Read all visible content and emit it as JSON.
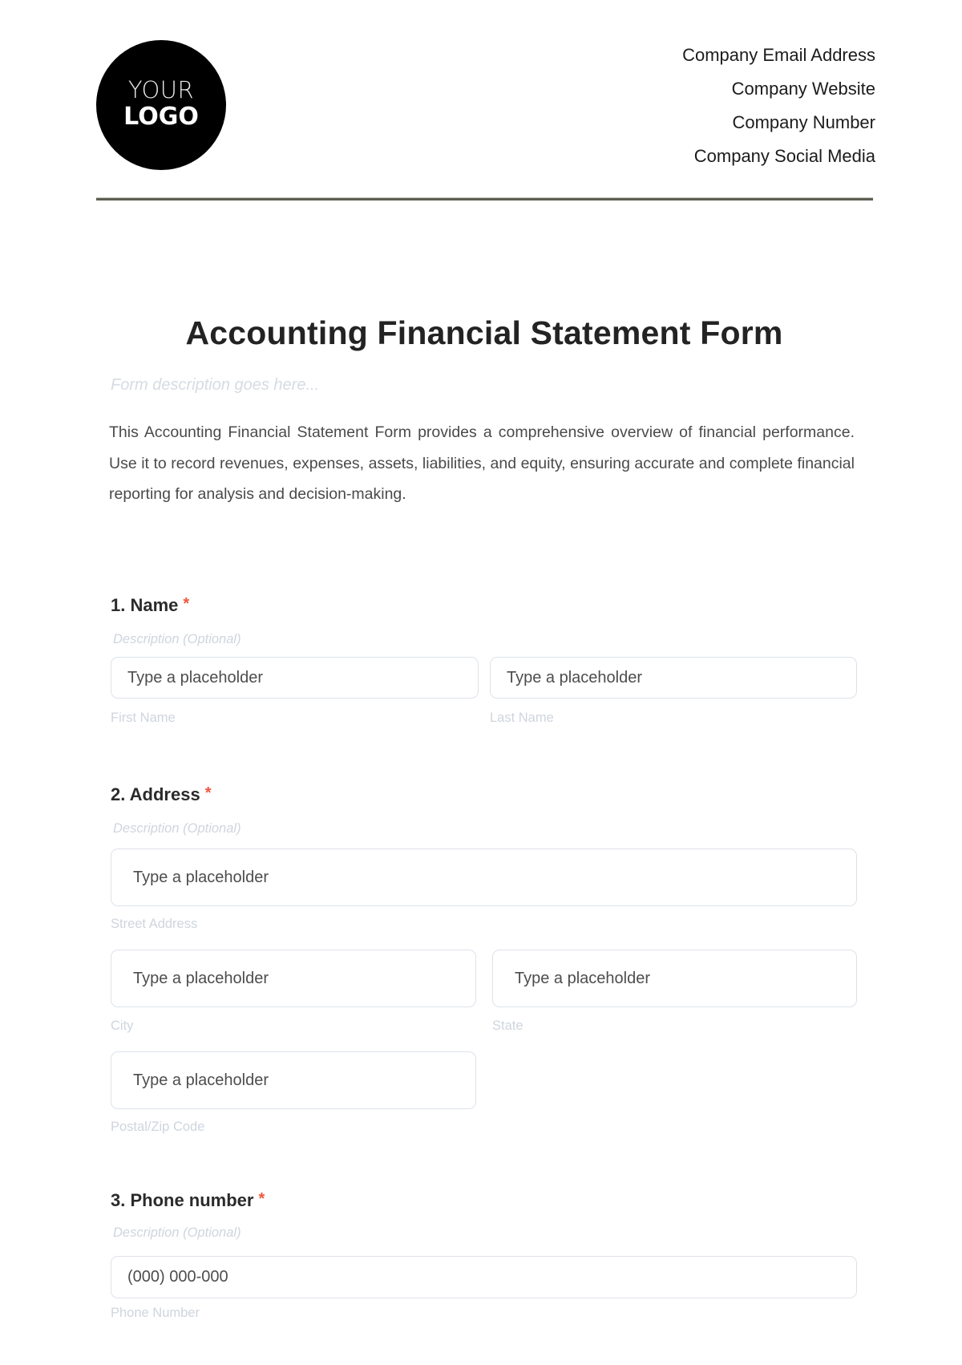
{
  "header": {
    "logo": {
      "line1": "YOUR",
      "line2": "LOGO"
    },
    "contact": [
      "Company Email Address",
      "Company Website",
      "Company Number",
      "Company Social Media"
    ]
  },
  "form": {
    "title": "Accounting Financial Statement Form",
    "description_placeholder": "Form description goes here...",
    "intro": "This Accounting Financial Statement Form provides a comprehensive overview of financial performance. Use it to record revenues, expenses, assets, liabilities, and equity, ensuring accurate and complete financial reporting for analysis and decision-making.",
    "required_marker": "*",
    "accent_color": "#f0563e",
    "questions": [
      {
        "title": "1. Name",
        "description": "Description (Optional)",
        "fields": [
          {
            "placeholder": "Type a placeholder",
            "label": "First Name"
          },
          {
            "placeholder": "Type a placeholder",
            "label": "Last Name"
          }
        ]
      },
      {
        "title": "2. Address",
        "description": "Description (Optional)",
        "fields": [
          {
            "placeholder": "Type a placeholder",
            "label": "Street Address"
          },
          {
            "placeholder": "Type a placeholder",
            "label": "City"
          },
          {
            "placeholder": "Type a placeholder",
            "label": "State"
          },
          {
            "placeholder": "Type a placeholder",
            "label": "Postal/Zip Code"
          }
        ]
      },
      {
        "title": "3. Phone number",
        "description": "Description (Optional)",
        "fields": [
          {
            "placeholder": "(000) 000-000",
            "label": "Phone Number"
          }
        ]
      }
    ]
  }
}
